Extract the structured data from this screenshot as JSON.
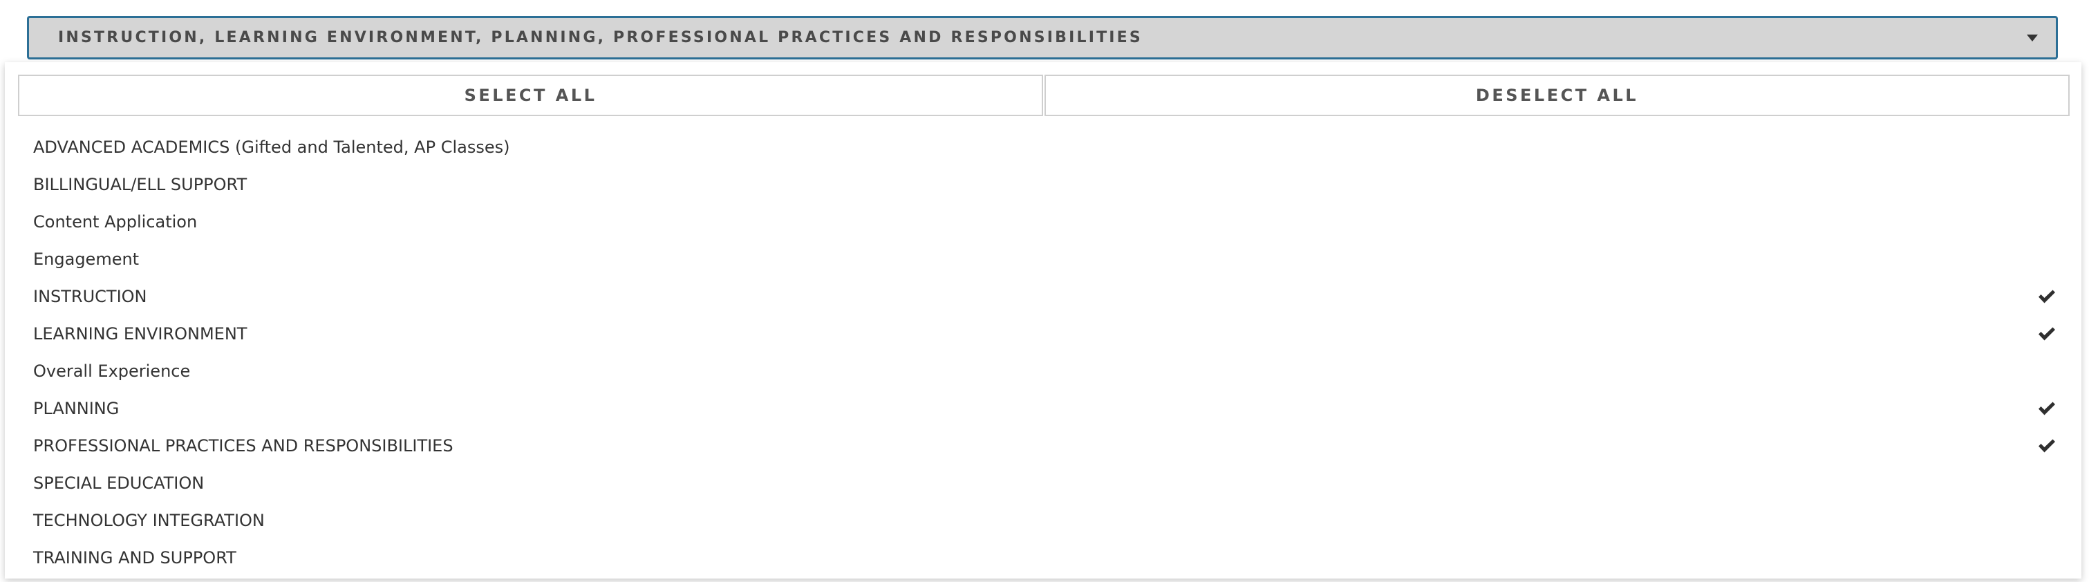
{
  "select": {
    "label": "INSTRUCTION, LEARNING ENVIRONMENT, PLANNING, PROFESSIONAL PRACTICES AND RESPONSIBILITIES",
    "caret_icon": "caret-down-icon",
    "border_color": "#2c6f96",
    "background_color": "#d5d5d5"
  },
  "actions": {
    "select_all_label": "SELECT ALL",
    "deselect_all_label": "DESELECT ALL"
  },
  "options": [
    {
      "label": "ADVANCED ACADEMICS (Gifted and Talented, AP Classes)",
      "selected": false
    },
    {
      "label": "BILLINGUAL/ELL SUPPORT",
      "selected": false
    },
    {
      "label": "Content Application",
      "selected": false
    },
    {
      "label": "Engagement",
      "selected": false
    },
    {
      "label": "INSTRUCTION",
      "selected": true
    },
    {
      "label": "LEARNING ENVIRONMENT",
      "selected": true
    },
    {
      "label": "Overall Experience",
      "selected": false
    },
    {
      "label": "PLANNING",
      "selected": true
    },
    {
      "label": "PROFESSIONAL PRACTICES AND RESPONSIBILITIES",
      "selected": true
    },
    {
      "label": "SPECIAL EDUCATION",
      "selected": false
    },
    {
      "label": "TECHNOLOGY INTEGRATION",
      "selected": false
    },
    {
      "label": "TRAINING AND SUPPORT",
      "selected": false
    }
  ],
  "check_icon": "checkmark-icon"
}
